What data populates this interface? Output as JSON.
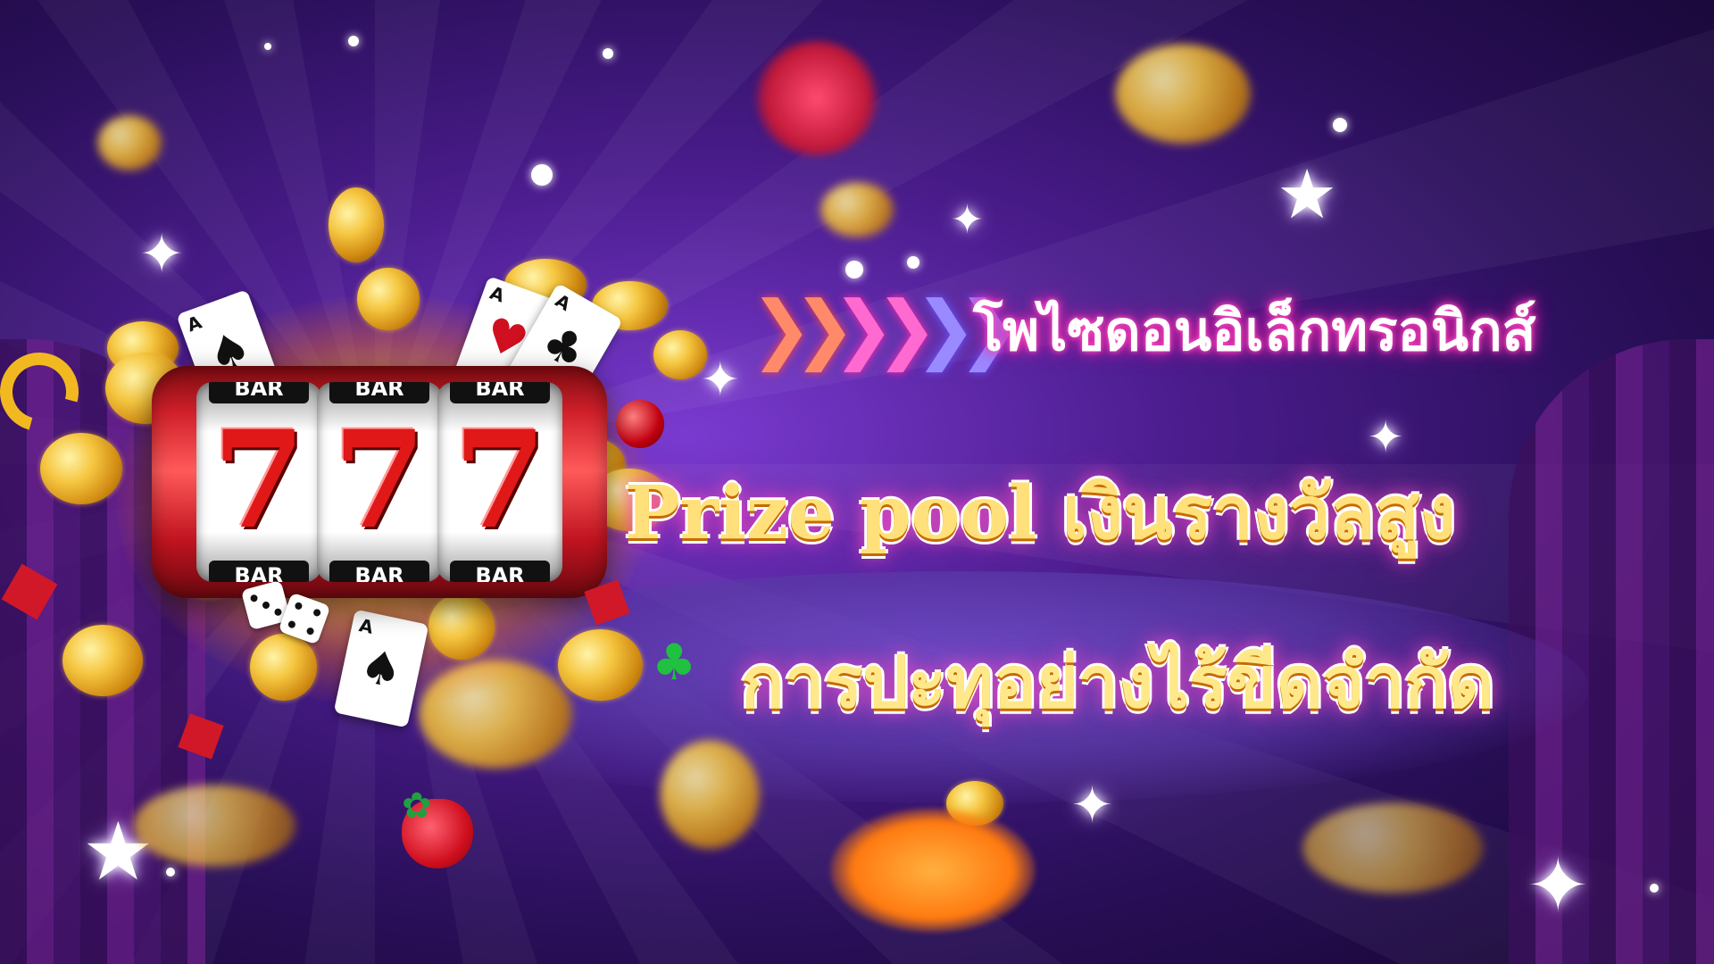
{
  "banner": {
    "subtitle": "โพไซดอนอิเล็กทรอนิกส์",
    "headline_line1": "Prize pool เงินรางวัลสูง",
    "headline_line2": "การปะทุอย่างไร้ขีดจำกัด"
  },
  "slot_machine": {
    "reels": [
      {
        "top": "BAR",
        "symbol": "7",
        "bottom": "BAR"
      },
      {
        "top": "BAR",
        "symbol": "7",
        "bottom": "BAR"
      },
      {
        "top": "BAR",
        "symbol": "7",
        "bottom": "BAR"
      }
    ]
  },
  "cards": [
    {
      "rank": "A",
      "suit": "♠"
    },
    {
      "rank": "A",
      "suit": "♥"
    },
    {
      "rank": "A",
      "suit": "♣"
    },
    {
      "rank": "A",
      "suit": "♠"
    }
  ],
  "icons": {
    "arrows": "triple-chevron-arrows-icon",
    "star": "sparkle-star-icon",
    "coin": "gold-coin-icon",
    "fruit": "strawberry-icon"
  },
  "colors": {
    "background": "#4a1c8c",
    "headline": "#ffe07a",
    "glow": "#ff2ab0"
  }
}
